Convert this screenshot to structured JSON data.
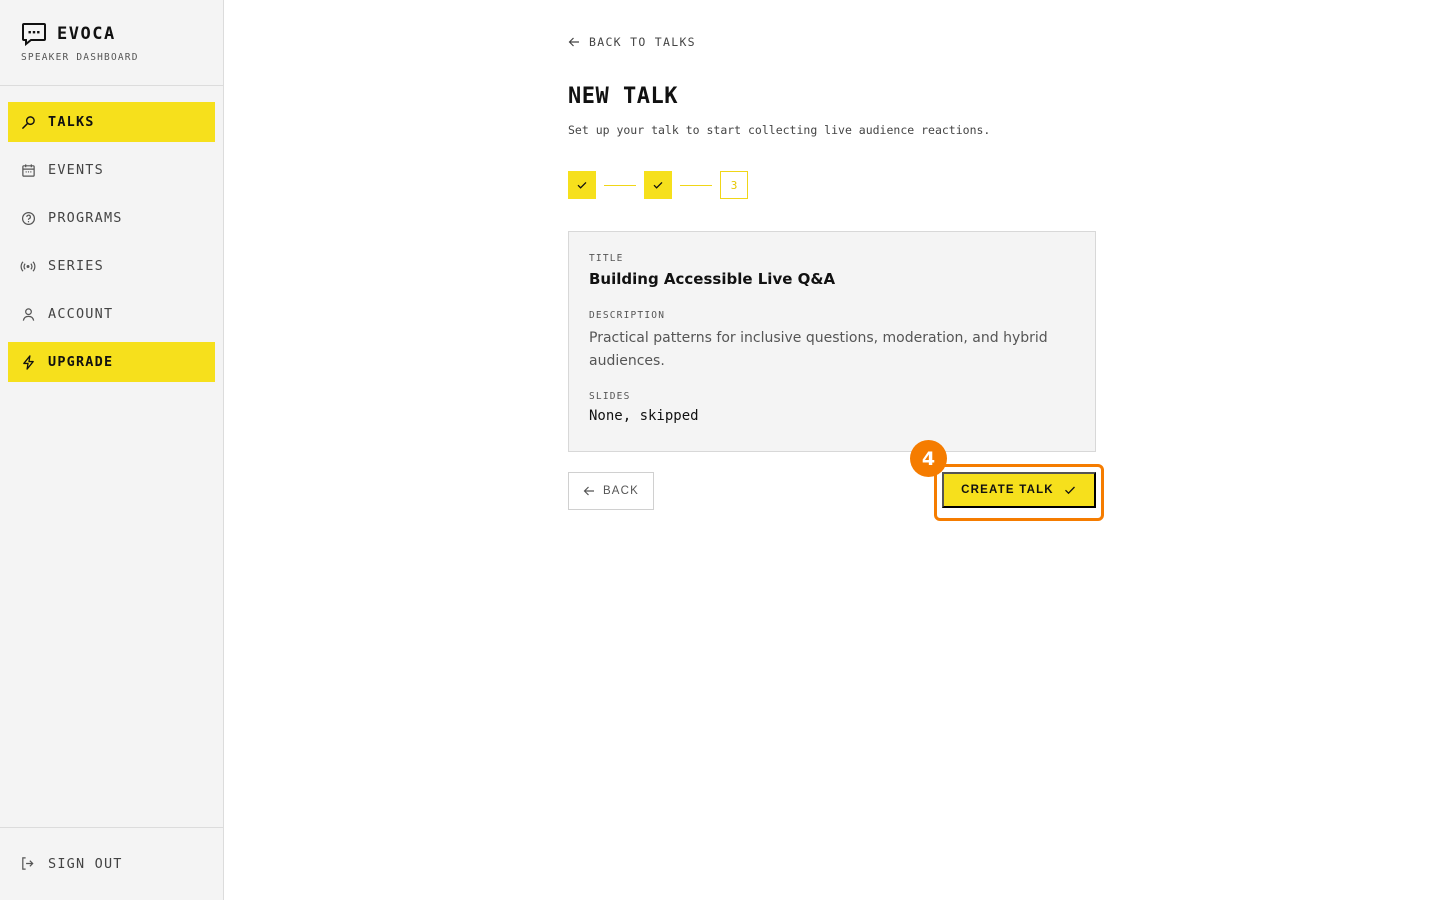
{
  "brand": {
    "name": "EVOCA",
    "subtitle": "SPEAKER DASHBOARD"
  },
  "sidebar": {
    "items": [
      {
        "label": "TALKS",
        "icon": "mic-icon",
        "active": true
      },
      {
        "label": "EVENTS",
        "icon": "calendar-icon",
        "active": false
      },
      {
        "label": "PROGRAMS",
        "icon": "help-circle-icon",
        "active": false
      },
      {
        "label": "SERIES",
        "icon": "broadcast-icon",
        "active": false
      },
      {
        "label": "ACCOUNT",
        "icon": "user-icon",
        "active": false
      }
    ],
    "upgrade": {
      "label": "UPGRADE",
      "icon": "lightning-icon"
    },
    "signout": {
      "label": "SIGN OUT",
      "icon": "sign-out-icon"
    }
  },
  "main": {
    "back_link": "BACK TO TALKS",
    "title": "NEW TALK",
    "subtitle": "Set up your talk to start collecting live audience reactions.",
    "stepper": {
      "steps": [
        "done",
        "done",
        "3"
      ],
      "current_step": 3
    },
    "summary": {
      "title_label": "TITLE",
      "title_value": "Building Accessible Live Q&A",
      "description_label": "DESCRIPTION",
      "description_value": "Practical patterns for inclusive questions, moderation, and hybrid audiences.",
      "slides_label": "SLIDES",
      "slides_value": "None, skipped"
    },
    "back_button": "BACK",
    "create_button": "CREATE TALK",
    "annotation_badge": "4"
  },
  "colors": {
    "accent": "#f6e01c",
    "highlight": "#f57c00",
    "sidebar_bg": "#f4f4f4"
  }
}
